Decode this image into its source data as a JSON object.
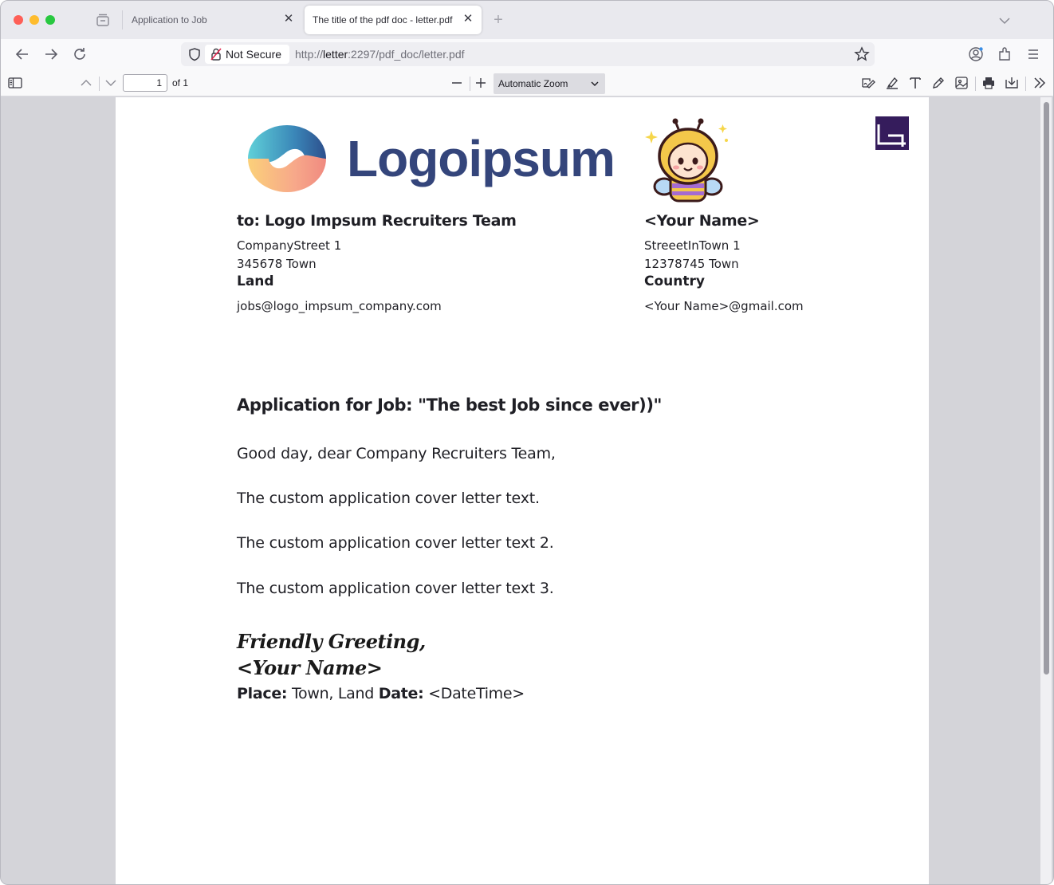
{
  "browser": {
    "tabs": [
      {
        "title": "Application to Job"
      },
      {
        "title": "The title of the pdf doc - letter.pdf"
      }
    ],
    "security_label": "Not Secure",
    "url_prefix": "http://",
    "url_host": "letter",
    "url_rest": ":2297/pdf_doc/letter.pdf"
  },
  "pdf_toolbar": {
    "page_number": "1",
    "page_count": "of 1",
    "zoom": "Automatic Zoom"
  },
  "letter": {
    "logo_text": "Logoipsum",
    "recipient": {
      "heading": "to: Logo Impsum Recruiters Team",
      "street": "CompanyStreet 1",
      "city": "345678  Town",
      "country": "Land",
      "email": "jobs@logo_impsum_company.com"
    },
    "sender": {
      "name": "<Your Name>",
      "street": "StreeetInTown 1",
      "city": "12378745  Town",
      "country": "Country",
      "email": "<Your Name>@gmail.com"
    },
    "subject": "Application for Job: \"The best Job since ever))\"",
    "greeting": "Good day, dear Company Recruiters Team,",
    "paragraphs": [
      "The custom application cover letter text.",
      "The custom application cover letter text 2.",
      "The custom application cover letter text 3."
    ],
    "closing": "Friendly Greeting,",
    "signature": "<Your Name>",
    "place_label": "Place:",
    "place_value": "Town, Land",
    "date_label": "Date:",
    "date_value": "<DateTime>"
  }
}
